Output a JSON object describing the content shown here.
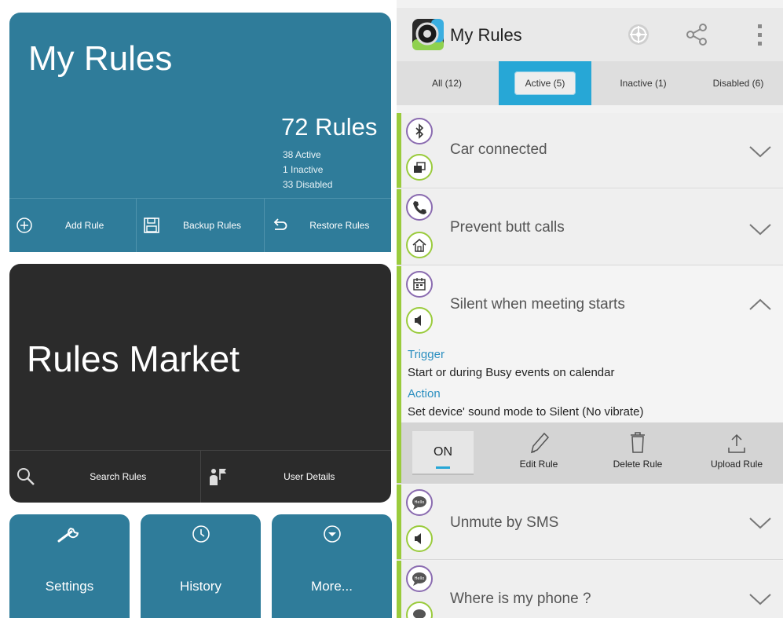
{
  "dashboard": {
    "title": "My Rules",
    "rule_count": "72 Rules",
    "stats": [
      "38 Active",
      "1 Inactive",
      "33 Disabled"
    ],
    "actions": [
      "Add Rule",
      "Backup Rules",
      "Restore Rules"
    ],
    "market": {
      "title": "Rules Market",
      "actions": [
        "Search Rules",
        "User Details"
      ]
    },
    "tiles": [
      "Settings",
      "History",
      "More..."
    ]
  },
  "app": {
    "title": "My Rules",
    "tabs": [
      "All (12)",
      "Active (5)",
      "Inactive (1)",
      "Disabled (6)"
    ],
    "active_tab": "Active (5)"
  },
  "rules": [
    {
      "name": "Car connected"
    },
    {
      "name": "Prevent butt calls"
    },
    {
      "name": "Silent when meeting starts",
      "trigger_label": "Trigger",
      "trigger": "Start or during Busy events on  calendar",
      "action_label": "Action",
      "action": "Set device' sound mode to Silent (No vibrate)"
    },
    {
      "name": "Unmute by SMS"
    },
    {
      "name": "Where is my phone ?"
    }
  ],
  "rule_toolbar": {
    "toggle": "ON",
    "edit": "Edit Rule",
    "delete": "Delete Rule",
    "upload": "Upload Rule"
  },
  "colors": {
    "teal": "#2f7c9a",
    "dark": "#2b2b2b",
    "accent_blue": "#27a7d6",
    "active_green": "#9acb3c",
    "trigger_purple": "#8a6bb0"
  }
}
